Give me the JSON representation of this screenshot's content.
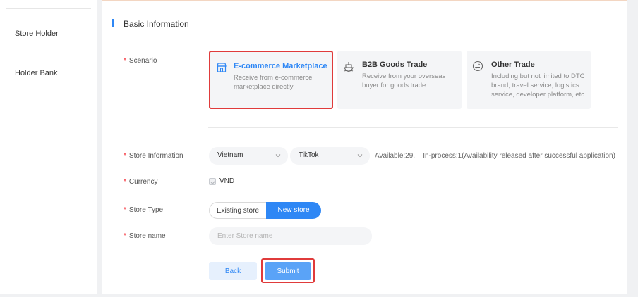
{
  "sidebar": {
    "items": [
      {
        "label": "Store Holder"
      },
      {
        "label": "Holder Bank"
      }
    ]
  },
  "section": {
    "title": "Basic Information"
  },
  "form": {
    "required_mark": "*",
    "scenario_label": "Scenario",
    "store_info_label": "Store Information",
    "currency_label": "Currency",
    "store_type_label": "Store Type",
    "store_name_label": "Store name"
  },
  "scenario_cards": [
    {
      "title": "E-commerce Marketplace",
      "desc": "Receive from e-commerce marketplace directly",
      "icon": "store-icon",
      "selected": true
    },
    {
      "title": "B2B Goods Trade",
      "desc": "Receive from your overseas buyer for goods trade",
      "icon": "ship-icon",
      "selected": false
    },
    {
      "title": "Other Trade",
      "desc": "Including but not limited to DTC brand, travel service, logistics service, developer platform, etc.",
      "icon": "exchange-icon",
      "selected": false
    }
  ],
  "store_info": {
    "country": "Vietnam",
    "platform": "TikTok",
    "availability": "Available:29,    In-process:1(Availability released after successful application)"
  },
  "currency": {
    "value": "VND",
    "checked": true
  },
  "store_type": {
    "options": [
      "Existing store",
      "New store"
    ],
    "selected": "New store"
  },
  "store_name": {
    "placeholder": "Enter Store name",
    "value": ""
  },
  "buttons": {
    "back": "Back",
    "submit": "Submit"
  },
  "colors": {
    "accent": "#2e87f5",
    "highlight": "#e03b3b",
    "required": "#f5222d"
  }
}
